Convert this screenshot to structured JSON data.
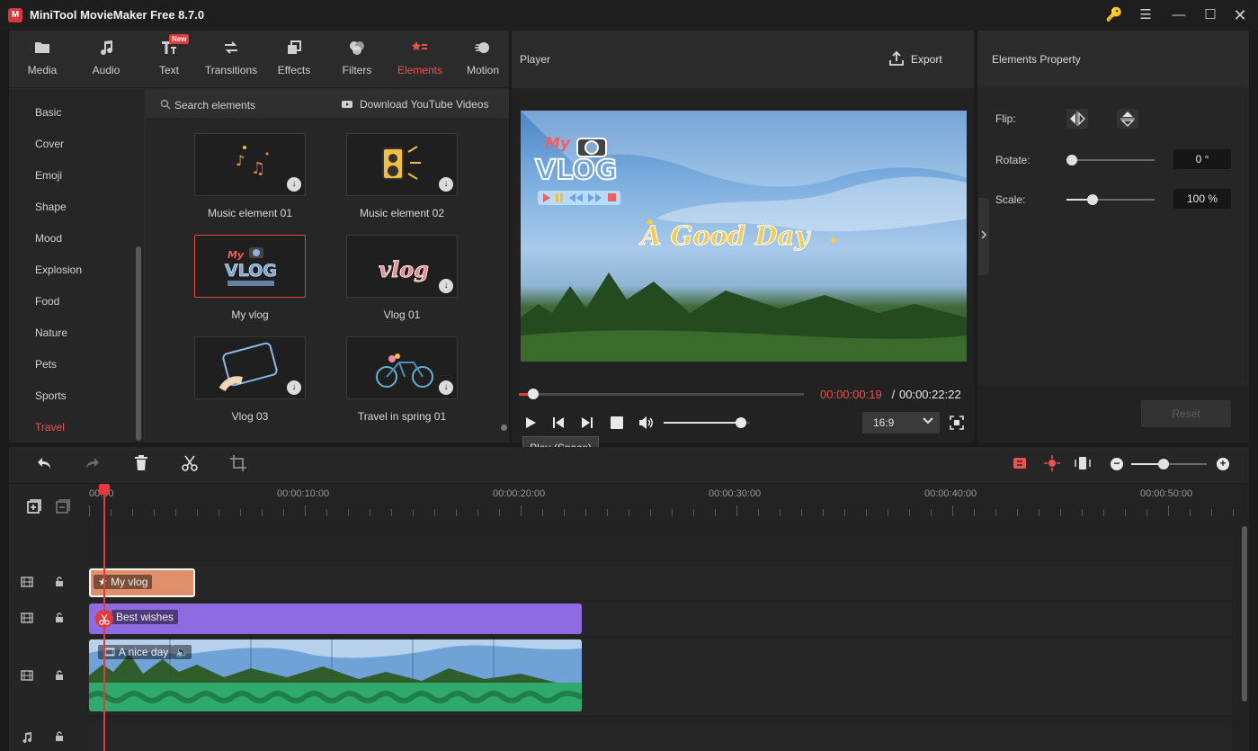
{
  "app": {
    "title": "MiniTool MovieMaker Free 8.7.0"
  },
  "tabs": [
    {
      "label": "Media",
      "icon": "folder-icon"
    },
    {
      "label": "Audio",
      "icon": "music-note-icon"
    },
    {
      "label": "Text",
      "icon": "text-icon",
      "badge": "New"
    },
    {
      "label": "Transitions",
      "icon": "swap-arrows-icon"
    },
    {
      "label": "Effects",
      "icon": "layers-icon"
    },
    {
      "label": "Filters",
      "icon": "circles-icon"
    },
    {
      "label": "Elements",
      "icon": "elements-icon",
      "active": true
    },
    {
      "label": "Motion",
      "icon": "motion-ball-icon"
    }
  ],
  "categories": [
    "Basic",
    "Cover",
    "Emoji",
    "Shape",
    "Mood",
    "Explosion",
    "Food",
    "Nature",
    "Pets",
    "Sports",
    "Travel"
  ],
  "active_category": "Travel",
  "search": {
    "placeholder": "Search elements",
    "download_link": "Download YouTube Videos"
  },
  "elements": [
    {
      "label": "Music element 01"
    },
    {
      "label": "Music element 02"
    },
    {
      "label": "My vlog",
      "selected": true
    },
    {
      "label": "Vlog 01"
    },
    {
      "label": "Vlog 03"
    },
    {
      "label": "Travel in spring 01"
    }
  ],
  "player": {
    "title": "Player",
    "export_label": "Export",
    "overlay_my": "My",
    "overlay_vlog": "VLOG",
    "overlay_text": "A Good Day",
    "current_time": "00:00:00:19",
    "separator": " / ",
    "total_time": "00:00:22:22",
    "aspect": "16:9",
    "tooltip": "Play (Space)",
    "progress_fraction": 0.05,
    "volume_fraction": 0.9
  },
  "properties": {
    "title": "Elements Property",
    "flip_label": "Flip:",
    "rotate_label": "Rotate:",
    "rotate_value": "0 °",
    "scale_label": "Scale:",
    "scale_value": "100 %",
    "reset_label": "Reset"
  },
  "timeline": {
    "ruler": [
      "00:00",
      "00:00:10:00",
      "00:00:20:00",
      "00:00:30:00",
      "00:00:40:00",
      "00:00:50:00"
    ],
    "clips": {
      "element": "My vlog",
      "text": "Best wishes",
      "video": "A nice day"
    }
  },
  "colors": {
    "accent": "#f0514f",
    "element_clip": "#e08f6b",
    "text_clip": "#8e6be0",
    "audio_wave": "#2faa6c"
  }
}
